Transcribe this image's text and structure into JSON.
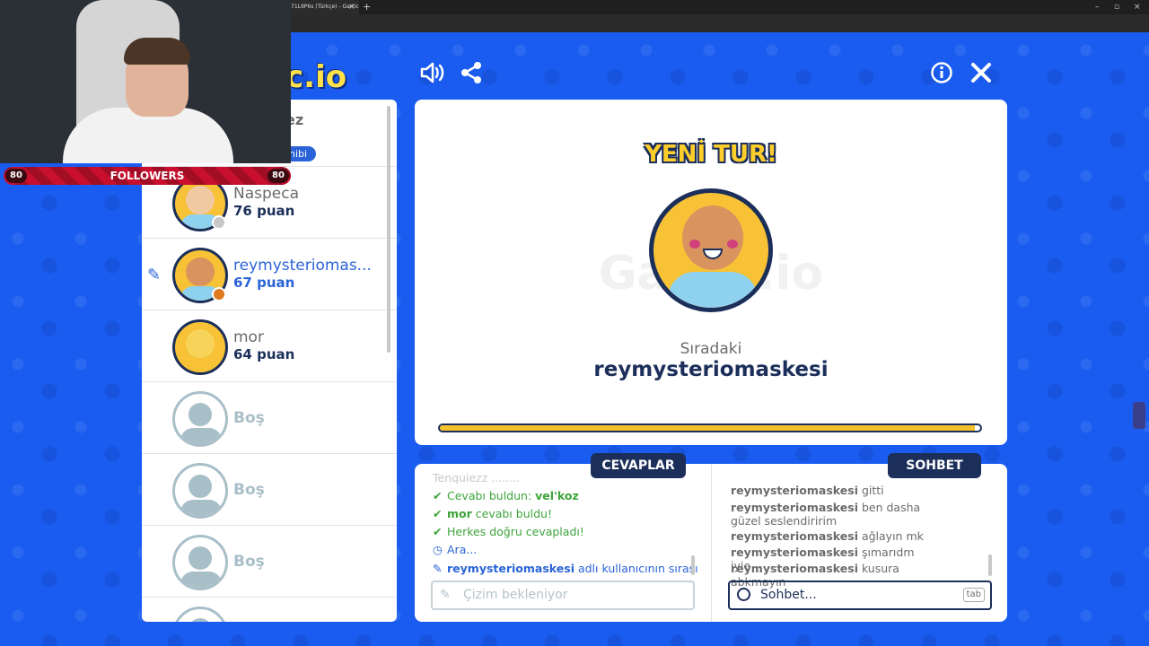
{
  "browser": {
    "tab_title": "71L9P6s (Türkçe) - Gartic",
    "tab_close": "×",
    "new_tab": "+"
  },
  "game": {
    "logo_text": "c.io",
    "sound_icon": "speaker-icon",
    "share_icon": "share-icon",
    "info_icon": "info-icon",
    "close_icon": "close-icon",
    "top_partial_name": "ez",
    "top_partial_badge": "nibi",
    "players": [
      {
        "name": "Naspeca",
        "score": "76 puan",
        "status_color": "#c8c8c8",
        "drawing": false
      },
      {
        "name": "reymysteriomas...",
        "score": "67 puan",
        "status_color": "#e07a1f",
        "drawing": true
      },
      {
        "name": "mor",
        "score": "64 puan",
        "status_color": "",
        "drawing": false
      }
    ],
    "empty_slots": [
      "Boş",
      "Boş",
      "Boş"
    ],
    "round_title": "YENİ TUR!",
    "watermark": "Gartic.io",
    "next_label": "Sıradaki",
    "next_player": "reymysteriomaskesi",
    "progress": 0.99,
    "answers_tab": "CEVAPLAR",
    "chat_tab": "SOHBET",
    "answers": {
      "ghost": "Tenquiezz ........",
      "line1_text": "Cevabı buldun: ",
      "line1_word": "vel'koz",
      "line2_name": "mor",
      "line2_rest": " cevabı buldu!",
      "line3": "Herkes doğru cevapladı!",
      "line4": "Ara...",
      "line5_name": "reymysteriomaskesi",
      "line5_rest": " adlı kullanıcının sırası"
    },
    "draw_placeholder": "Çizim bekleniyor",
    "chat": [
      {
        "user": "reymysteriomaskesi",
        "msg": " gitti"
      },
      {
        "user": "reymysteriomaskesi",
        "msg": " ben dasha güzel seslendiririm"
      },
      {
        "user": "reymysteriomaskesi",
        "msg": " ağlayın mk"
      },
      {
        "user": "reymysteriomaskesi",
        "msg": " şımarıdm iyie"
      },
      {
        "user": "reymysteriomaskesi",
        "msg": " kusura abkmayın"
      }
    ],
    "chat_placeholder": "Sohbet...",
    "tab_key": "tab"
  },
  "stream": {
    "followers_label": "FOLLOWERS",
    "followers_left": "80",
    "followers_right": "80"
  }
}
